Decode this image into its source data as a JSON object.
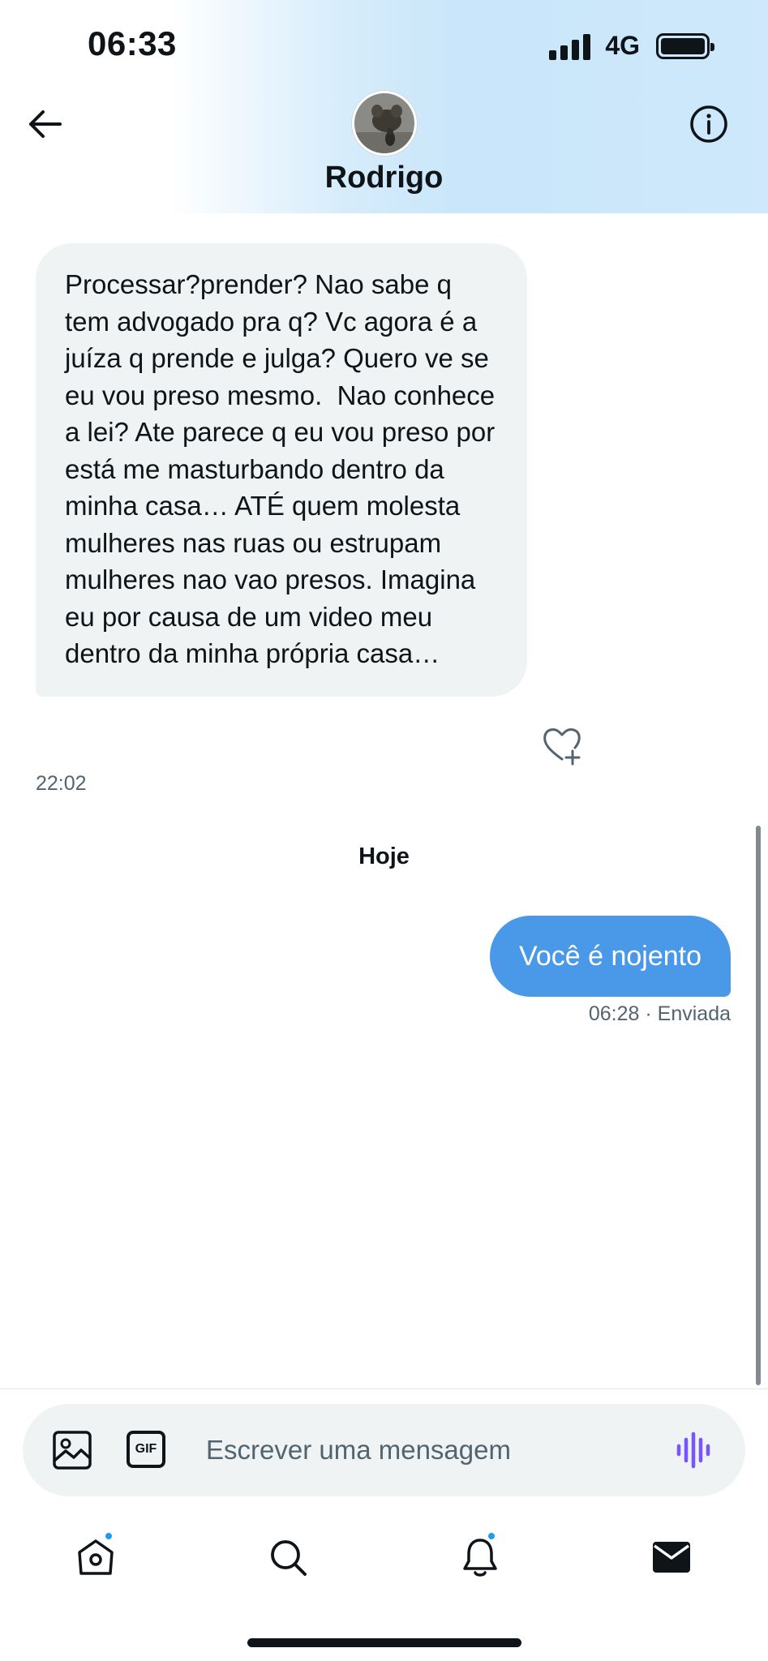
{
  "status_bar": {
    "time": "06:33",
    "network": "4G"
  },
  "header": {
    "contact_name": "Rodrigo"
  },
  "messages": {
    "incoming": {
      "text": "Processar?prender? Nao sabe q tem advogado pra q? Vc agora é a juíza q prende e julga? Quero ve se eu vou preso mesmo.  Nao conhece a lei? Ate parece q eu vou preso por está me masturbando dentro da minha casa… ATÉ quem molesta mulheres nas ruas ou estrupam mulheres nao vao presos. Imagina eu por causa de um video meu dentro da minha própria casa…",
      "time": "22:02"
    },
    "day_separator": "Hoje",
    "outgoing": {
      "text": "Você é nojento",
      "meta": "06:28 · Enviada"
    }
  },
  "composer": {
    "placeholder": "Escrever uma mensagem",
    "gif_label": "GIF"
  },
  "icons": {
    "back": "arrow-left-icon",
    "info": "info-icon",
    "like": "heart-plus-icon",
    "media": "image-icon",
    "voice": "voice-wave-icon",
    "home": "home-icon",
    "search": "search-icon",
    "notifications": "bell-icon",
    "messages": "envelope-icon"
  },
  "colors": {
    "accent": "#1d9bf0",
    "outgoing_bubble": "#4a99e9",
    "incoming_bubble": "#eff3f4",
    "voice": "#7856ff"
  }
}
